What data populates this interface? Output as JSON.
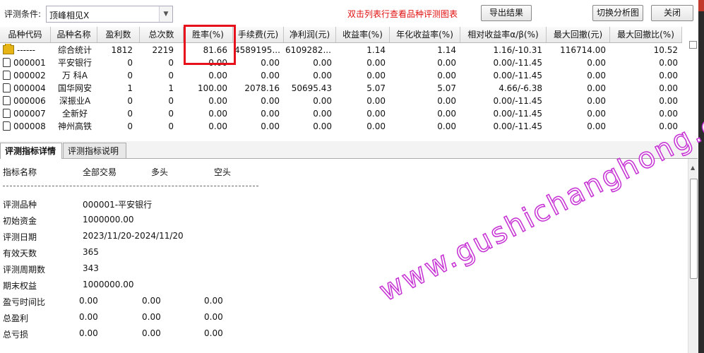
{
  "toolbar": {
    "condition_label": "评测条件:",
    "condition_value": "顶峰相见X",
    "hint": "双击列表行查看品种评测图表",
    "export_btn": "导出结果",
    "switch_btn": "切换分析图",
    "close_btn": "关闭"
  },
  "table": {
    "headers": [
      "品种代码",
      "品种名称",
      "盈利数",
      "总次数",
      "胜率(%)",
      "手续费(元)",
      "净利润(元)",
      "收益率(%)",
      "年化收益率(%)",
      "相对收益率α/β(%)",
      "最大回撤(元)",
      "最大回撤比(%)"
    ],
    "rows": [
      {
        "code": "------",
        "name": "综合统计",
        "profit": "1812",
        "total": "2219",
        "win": "81.66",
        "fee": "4589195....",
        "net": "6109282....",
        "ret": "1.14",
        "annual": "1.14",
        "rel": "1.16/-10.31",
        "dd": "116714.00",
        "ddr": "10.52",
        "icon": "folder"
      },
      {
        "code": "000001",
        "name": "平安银行",
        "profit": "0",
        "total": "0",
        "win": "0.00",
        "fee": "0.00",
        "net": "0.00",
        "ret": "0.00",
        "annual": "0.00",
        "rel": "0.00/-11.45",
        "dd": "0.00",
        "ddr": "0.00",
        "icon": "doc"
      },
      {
        "code": "000002",
        "name": "万 科A",
        "profit": "0",
        "total": "0",
        "win": "0.00",
        "fee": "0.00",
        "net": "0.00",
        "ret": "0.00",
        "annual": "0.00",
        "rel": "0.00/-11.45",
        "dd": "0.00",
        "ddr": "0.00",
        "icon": "doc"
      },
      {
        "code": "000004",
        "name": "国华网安",
        "profit": "1",
        "total": "1",
        "win": "100.00",
        "fee": "2078.16",
        "net": "50695.43",
        "ret": "5.07",
        "annual": "5.07",
        "rel": "4.66/-6.38",
        "dd": "0.00",
        "ddr": "0.00",
        "icon": "doc"
      },
      {
        "code": "000006",
        "name": "深振业A",
        "profit": "0",
        "total": "0",
        "win": "0.00",
        "fee": "0.00",
        "net": "0.00",
        "ret": "0.00",
        "annual": "0.00",
        "rel": "0.00/-11.45",
        "dd": "0.00",
        "ddr": "0.00",
        "icon": "doc"
      },
      {
        "code": "000007",
        "name": "全新好",
        "profit": "0",
        "total": "0",
        "win": "0.00",
        "fee": "0.00",
        "net": "0.00",
        "ret": "0.00",
        "annual": "0.00",
        "rel": "0.00/-11.45",
        "dd": "0.00",
        "ddr": "0.00",
        "icon": "doc"
      },
      {
        "code": "000008",
        "name": "神州高铁",
        "profit": "0",
        "total": "0",
        "win": "0.00",
        "fee": "0.00",
        "net": "0.00",
        "ret": "0.00",
        "annual": "0.00",
        "rel": "0.00/-11.45",
        "dd": "0.00",
        "ddr": "0.00",
        "icon": "doc"
      }
    ]
  },
  "tabs": [
    "评测指标详情",
    "评测指标说明"
  ],
  "detail": {
    "header": {
      "name": "指标名称",
      "all": "全部交易",
      "long": "多头",
      "short": "空头"
    },
    "rows": [
      {
        "label": "评测品种",
        "v1": "000001-平安银行"
      },
      {
        "label": "初始资金",
        "v1": "1000000.00"
      },
      {
        "label": "评测日期",
        "v1": "2023/11/20-2024/11/20"
      },
      {
        "label": "有效天数",
        "v1": "365"
      },
      {
        "label": "评测周期数",
        "v1": "343"
      },
      {
        "label": "期末权益",
        "v1": "1000000.00"
      },
      {
        "label": "盈亏时间比",
        "v1": "0.00",
        "v2": "0.00",
        "v3": "0.00"
      },
      {
        "label": "总盈利",
        "v1": "0.00",
        "v2": "0.00",
        "v3": "0.00"
      },
      {
        "label": "总亏损",
        "v1": "0.00",
        "v2": "0.00",
        "v3": "0.00"
      }
    ]
  },
  "watermark": "www.gushichanghong.com",
  "colors": {
    "highlight": "#e8101a",
    "hint": "#e01010",
    "watermark": "#c62fd4"
  }
}
